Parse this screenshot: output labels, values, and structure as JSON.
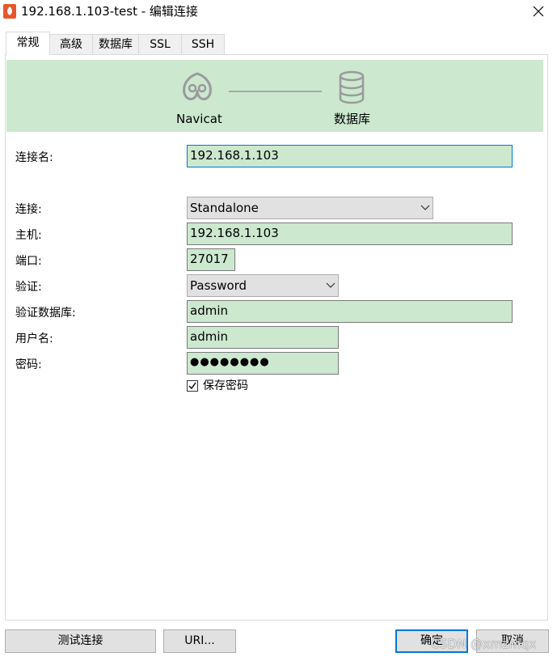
{
  "window": {
    "title": "192.168.1.103-test - 编辑连接"
  },
  "tabs": [
    {
      "label": "常规",
      "active": true
    },
    {
      "label": "高级",
      "active": false
    },
    {
      "label": "数据库",
      "active": false
    },
    {
      "label": "SSL",
      "active": false
    },
    {
      "label": "SSH",
      "active": false
    }
  ],
  "banner": {
    "left_label": "Navicat",
    "right_label": "数据库"
  },
  "form": {
    "connection_name": {
      "label": "连接名:",
      "value": "192.168.1.103"
    },
    "connection": {
      "label": "连接:",
      "value": "Standalone"
    },
    "host": {
      "label": "主机:",
      "value": "192.168.1.103"
    },
    "port": {
      "label": "端口:",
      "value": "27017"
    },
    "auth": {
      "label": "验证:",
      "value": "Password"
    },
    "auth_db": {
      "label": "验证数据库:",
      "value": "admin"
    },
    "username": {
      "label": "用户名:",
      "value": "admin"
    },
    "password": {
      "label": "密码:",
      "value": "●●●●●●●●"
    },
    "save_password": {
      "label": "保存密码",
      "checked": true
    }
  },
  "buttons": {
    "test": "测试连接",
    "uri": "URI...",
    "ok": "确定",
    "cancel": "取消"
  },
  "watermark": "CSDN @xmzmqx",
  "colors": {
    "accent": "#0078d7",
    "field_bg": "#cce8cf",
    "banner_bg": "#cce8cf"
  }
}
